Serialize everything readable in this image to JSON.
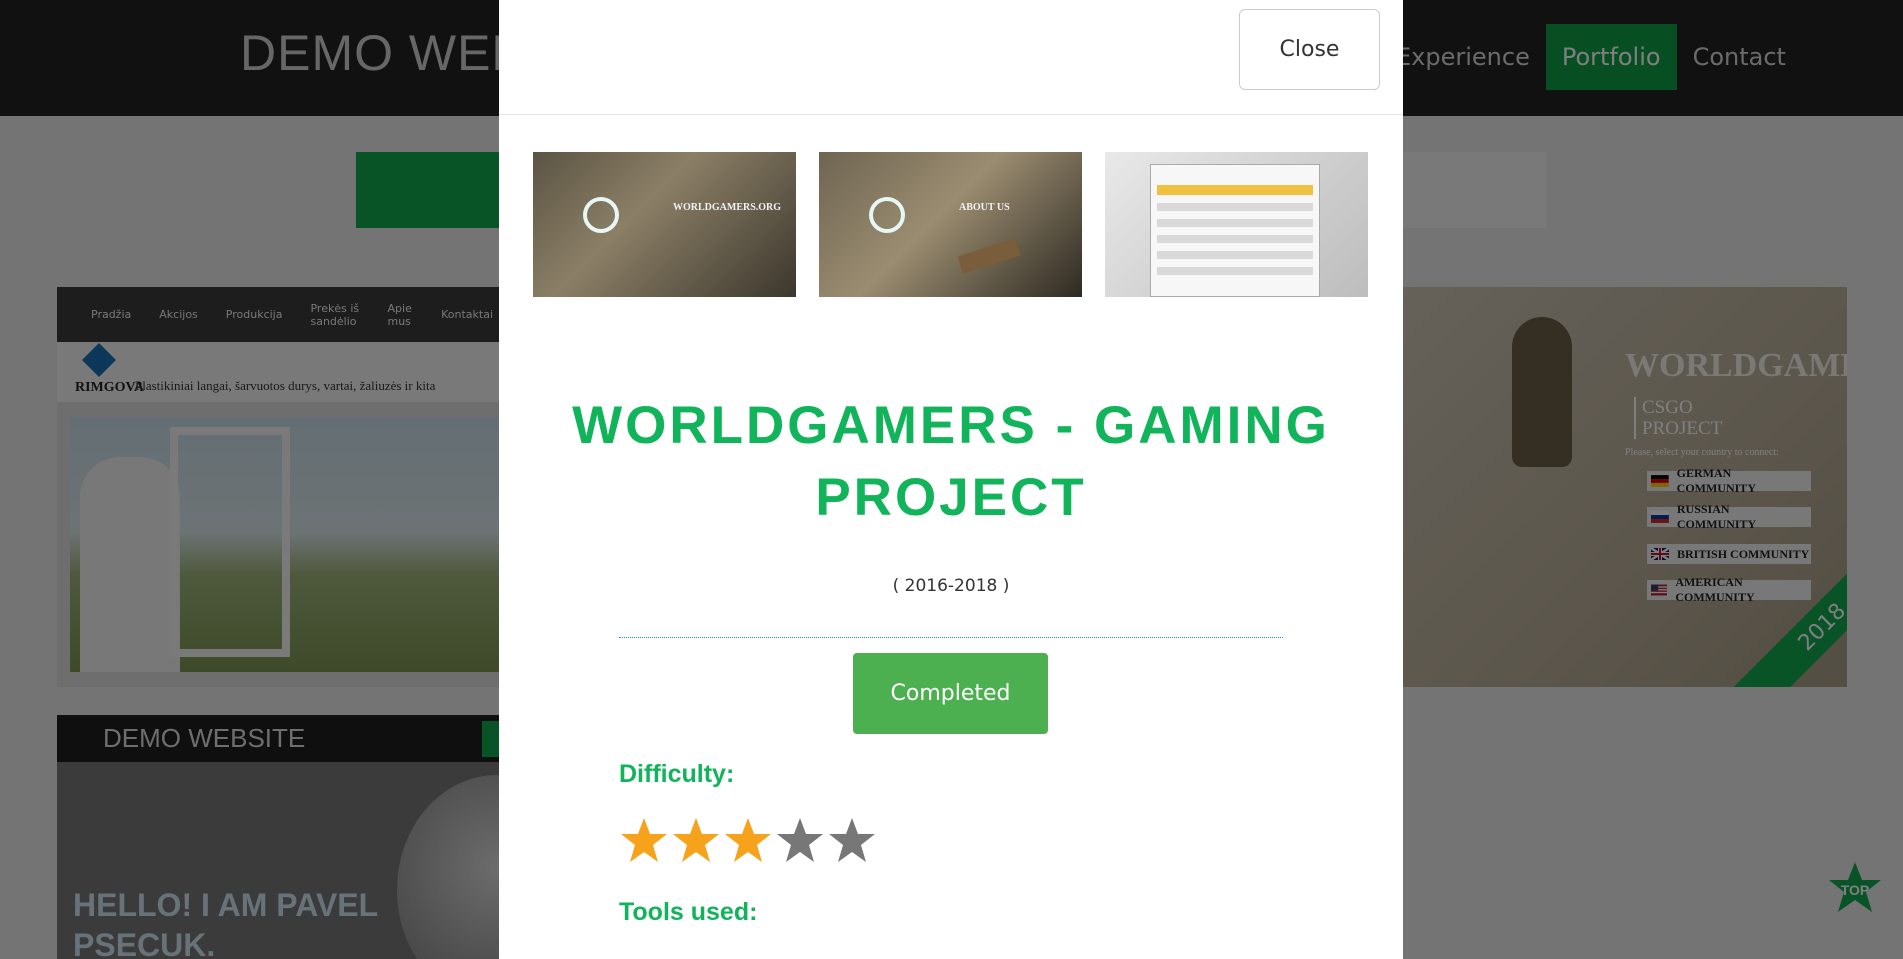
{
  "background": {
    "brand": "DEMO WEBSITE",
    "nav": {
      "items": [
        "Experience",
        "Portfolio",
        "Contact"
      ],
      "active": "Portfolio"
    },
    "card1": {
      "menu": [
        "Pradžia",
        "Akcijos",
        "Produkcija",
        "Prekės iš sandėlio",
        "Apie mus",
        "Kontaktai"
      ],
      "logo": "RIMGOVA",
      "tagline": "Plastikiniai langai, šarvuotos durys, vartai, žaliuzės ir kita"
    },
    "card2": {
      "title": "DEMO WEBSITE",
      "hello": "HELLO! I AM PAVEL PSECUK."
    },
    "card3": {
      "title": "WORLDGAMERS",
      "sub1": "CSGO",
      "sub2": "PROJECT",
      "select": "Please, select your country to connect:",
      "communities": [
        "GERMAN COMMUNITY",
        "RUSSIAN COMMUNITY",
        "BRITISH COMMUNITY",
        "AMERICAN COMMUNITY"
      ],
      "ribbon": "2018"
    },
    "top_button": "TOP"
  },
  "modal": {
    "close_label": "Close",
    "thumbnails": [
      {
        "name": "worldgamers-home-thumb",
        "caption": "WORLDGAMERS.ORG"
      },
      {
        "name": "worldgamers-about-thumb",
        "caption": "ABOUT US"
      },
      {
        "name": "worldgamers-forum-thumb",
        "caption": ""
      }
    ],
    "title": "WORLDGAMERS - GAMING PROJECT",
    "years": "( 2016-2018 )",
    "status": "Completed",
    "difficulty_label": "Difficulty:",
    "difficulty_rating": 3,
    "difficulty_max": 5,
    "tools_label": "Tools used:"
  },
  "colors": {
    "accent_green": "#11b45a",
    "status_green": "#4caf50",
    "nav_active": "#0e9d46",
    "star_filled": "#f6a21a",
    "star_empty": "#777777"
  }
}
